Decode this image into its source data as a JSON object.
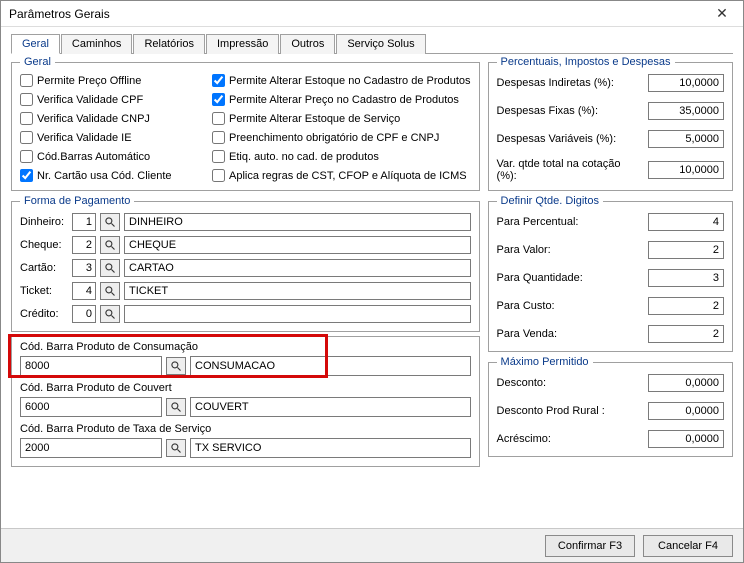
{
  "window": {
    "title": "Parâmetros Gerais"
  },
  "tabs": {
    "items": [
      {
        "label": "Geral",
        "active": true
      },
      {
        "label": "Caminhos"
      },
      {
        "label": "Relatórios"
      },
      {
        "label": "Impressão"
      },
      {
        "label": "Outros"
      },
      {
        "label": "Serviço Solus"
      }
    ]
  },
  "geral": {
    "legend": "Geral",
    "left": [
      {
        "label": "Permite Preço Offline",
        "checked": false
      },
      {
        "label": "Verifica Validade CPF",
        "checked": false
      },
      {
        "label": "Verifica Validade CNPJ",
        "checked": false
      },
      {
        "label": "Verifica Validade IE",
        "checked": false
      },
      {
        "label": "Cód.Barras Automático",
        "checked": false
      },
      {
        "label": "Nr. Cartão usa Cód. Cliente",
        "checked": true
      }
    ],
    "right": [
      {
        "label": "Permite Alterar Estoque no Cadastro de Produtos",
        "checked": true
      },
      {
        "label": "Permite Alterar Preço no Cadastro de Produtos",
        "checked": true
      },
      {
        "label": "Permite Alterar Estoque de Serviço",
        "checked": false
      },
      {
        "label": "Preenchimento obrigatório de CPF e CNPJ",
        "checked": false
      },
      {
        "label": "Etiq. auto. no cad. de produtos",
        "checked": false
      },
      {
        "label": "Aplica regras de CST, CFOP e Alíquota de ICMS",
        "checked": false
      }
    ]
  },
  "pagamento": {
    "legend": "Forma de Pagamento",
    "rows": [
      {
        "label": "Dinheiro:",
        "num": "1",
        "desc": "DINHEIRO"
      },
      {
        "label": "Cheque:",
        "num": "2",
        "desc": "CHEQUE"
      },
      {
        "label": "Cartão:",
        "num": "3",
        "desc": "CARTAO"
      },
      {
        "label": "Ticket:",
        "num": "4",
        "desc": "TICKET"
      },
      {
        "label": "Crédito:",
        "num": "0",
        "desc": ""
      }
    ]
  },
  "codigos": {
    "consumacao": {
      "head": "Cód. Barra Produto de Consumação",
      "code": "8000",
      "desc": "CONSUMACAO"
    },
    "couvert": {
      "head": "Cód. Barra Produto de Couvert",
      "code": "6000",
      "desc": "COUVERT"
    },
    "servico": {
      "head": "Cód. Barra Produto de Taxa de Serviço",
      "code": "2000",
      "desc": "TX SERVICO"
    }
  },
  "percentuais": {
    "legend": "Percentuais, Impostos e Despesas",
    "rows": [
      {
        "label": "Despesas Indiretas (%):",
        "value": "10,0000"
      },
      {
        "label": "Despesas Fixas (%):",
        "value": "35,0000"
      },
      {
        "label": "Despesas Variáveis (%):",
        "value": "5,0000"
      },
      {
        "label": "Var. qtde total na cotação (%):",
        "value": "10,0000"
      }
    ]
  },
  "digitos": {
    "legend": "Definir Qtde. Digitos",
    "rows": [
      {
        "label": "Para Percentual:",
        "value": "4"
      },
      {
        "label": "Para Valor:",
        "value": "2"
      },
      {
        "label": "Para Quantidade:",
        "value": "3"
      },
      {
        "label": "Para Custo:",
        "value": "2"
      },
      {
        "label": "Para Venda:",
        "value": "2"
      }
    ]
  },
  "maximo": {
    "legend": "Máximo Permitido",
    "rows": [
      {
        "label": "Desconto:",
        "value": "0,0000"
      },
      {
        "label": "Desconto Prod Rural :",
        "value": "0,0000"
      },
      {
        "label": "Acréscimo:",
        "value": "0,0000"
      }
    ]
  },
  "footer": {
    "confirm": "Confirmar F3",
    "cancel": "Cancelar F4"
  }
}
